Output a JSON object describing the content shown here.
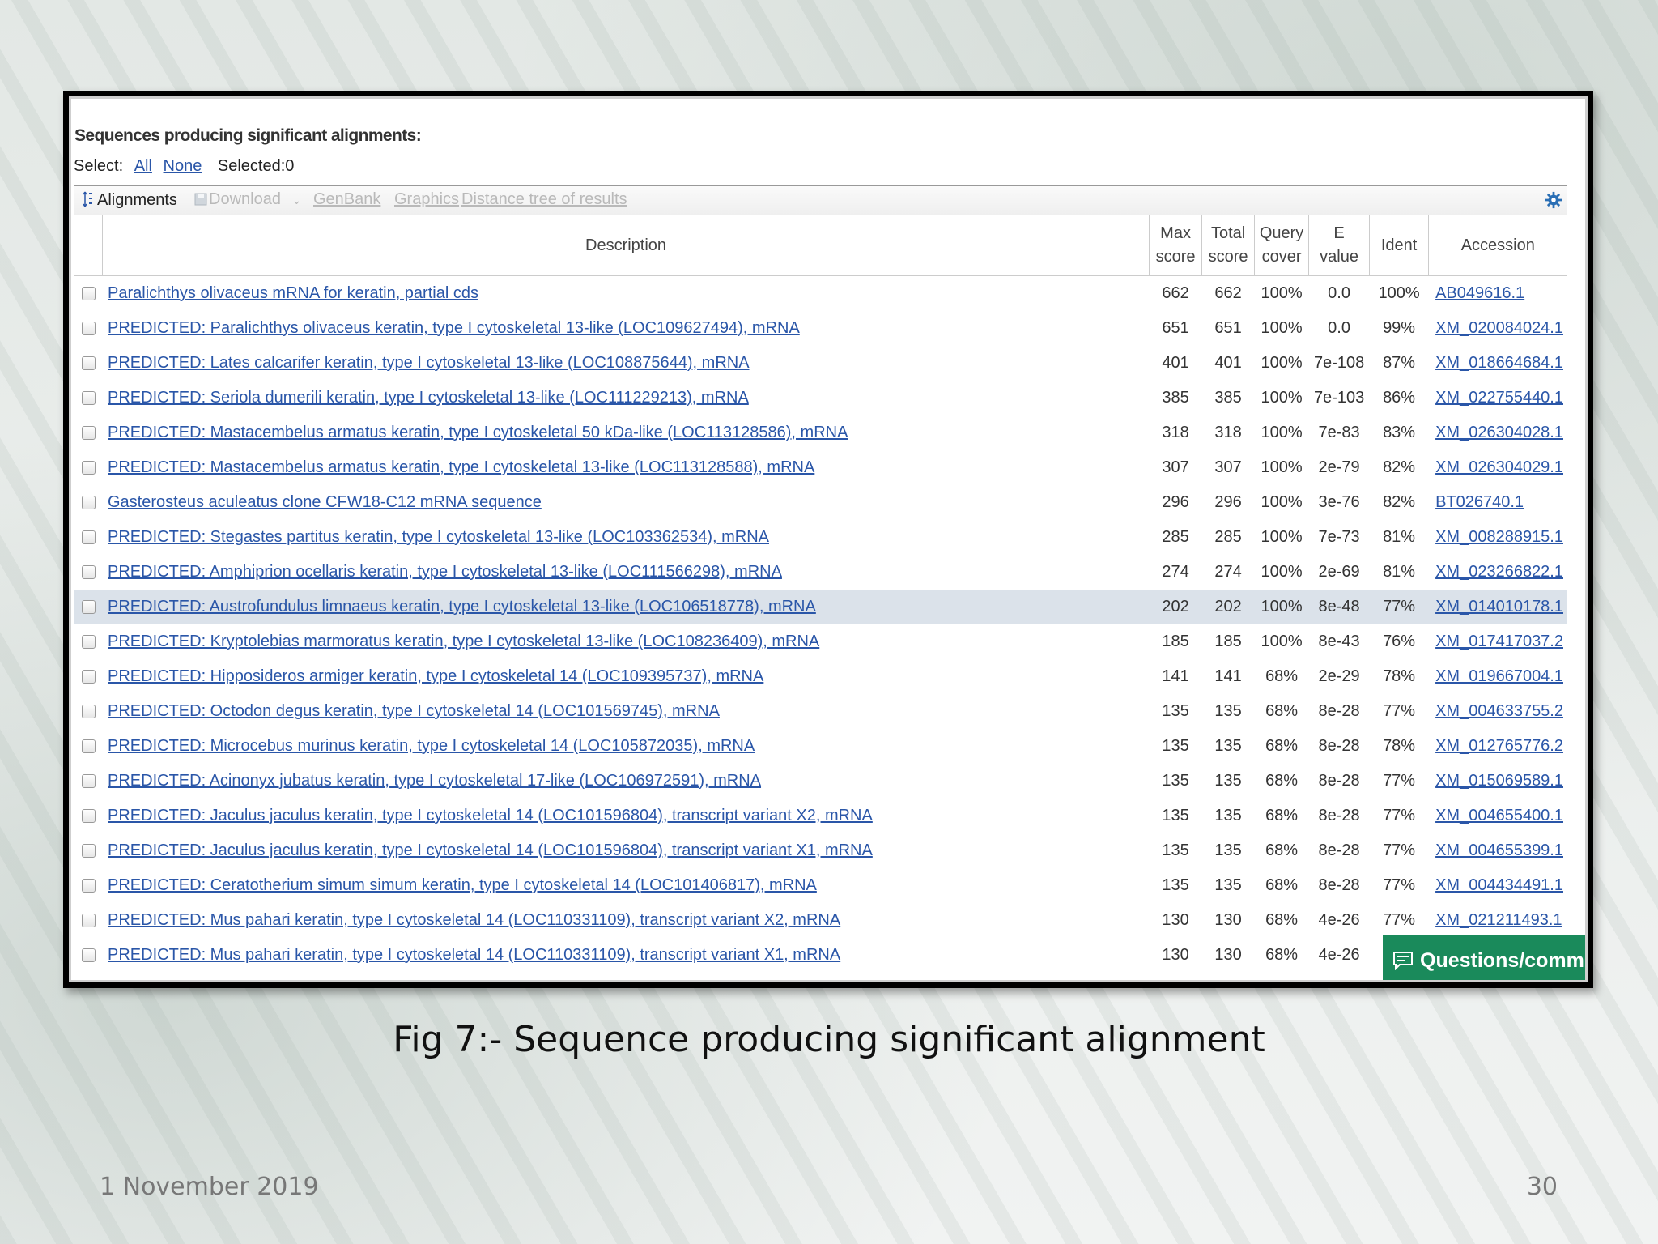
{
  "slide": {
    "caption": "Fig  7:- Sequence producing significant alignment",
    "date": "1 November 2019",
    "page_number": "30"
  },
  "blast": {
    "heading": "Sequences producing significant alignments:",
    "select_label": "Select:",
    "select_all": "All",
    "select_none": "None",
    "selected_text": "Selected:0",
    "toolbar": {
      "alignments": "Alignments",
      "download": "Download",
      "genbank": "GenBank",
      "graphics": "Graphics",
      "distance_tree": "Distance tree of results",
      "settings_icon": "gear-icon"
    },
    "columns": {
      "description": "Description",
      "max_score_1": "Max",
      "max_score_2": "score",
      "total_score_1": "Total",
      "total_score_2": "score",
      "query_cover_1": "Query",
      "query_cover_2": "cover",
      "e_value_1": "E",
      "e_value_2": "value",
      "ident": "Ident",
      "accession": "Accession"
    },
    "rows": [
      {
        "description": "Paralichthys olivaceus mRNA for keratin, partial cds",
        "max": "662",
        "total": "662",
        "cover": "100%",
        "evalue": "0.0",
        "ident": "100%",
        "accession": "AB049616.1"
      },
      {
        "description": "PREDICTED: Paralichthys olivaceus keratin, type I cytoskeletal 13-like (LOC109627494), mRNA",
        "max": "651",
        "total": "651",
        "cover": "100%",
        "evalue": "0.0",
        "ident": "99%",
        "accession": "XM_020084024.1"
      },
      {
        "description": "PREDICTED: Lates calcarifer keratin, type I cytoskeletal 13-like (LOC108875644), mRNA",
        "max": "401",
        "total": "401",
        "cover": "100%",
        "evalue": "7e-108",
        "ident": "87%",
        "accession": "XM_018664684.1"
      },
      {
        "description": "PREDICTED: Seriola dumerili keratin, type I cytoskeletal 13-like (LOC111229213), mRNA",
        "max": "385",
        "total": "385",
        "cover": "100%",
        "evalue": "7e-103",
        "ident": "86%",
        "accession": "XM_022755440.1"
      },
      {
        "description": "PREDICTED: Mastacembelus armatus keratin, type I cytoskeletal 50 kDa-like (LOC113128586), mRNA",
        "max": "318",
        "total": "318",
        "cover": "100%",
        "evalue": "7e-83",
        "ident": "83%",
        "accession": "XM_026304028.1"
      },
      {
        "description": "PREDICTED: Mastacembelus armatus keratin, type I cytoskeletal 13-like (LOC113128588), mRNA",
        "max": "307",
        "total": "307",
        "cover": "100%",
        "evalue": "2e-79",
        "ident": "82%",
        "accession": "XM_026304029.1"
      },
      {
        "description": "Gasterosteus aculeatus clone CFW18-C12 mRNA sequence",
        "max": "296",
        "total": "296",
        "cover": "100%",
        "evalue": "3e-76",
        "ident": "82%",
        "accession": "BT026740.1"
      },
      {
        "description": "PREDICTED: Stegastes partitus keratin, type I cytoskeletal 13-like (LOC103362534), mRNA",
        "max": "285",
        "total": "285",
        "cover": "100%",
        "evalue": "7e-73",
        "ident": "81%",
        "accession": "XM_008288915.1"
      },
      {
        "description": "PREDICTED: Amphiprion ocellaris keratin, type I cytoskeletal 13-like (LOC111566298), mRNA",
        "max": "274",
        "total": "274",
        "cover": "100%",
        "evalue": "2e-69",
        "ident": "81%",
        "accession": "XM_023266822.1"
      },
      {
        "description": "PREDICTED: Austrofundulus limnaeus keratin, type I cytoskeletal 13-like (LOC106518778), mRNA",
        "max": "202",
        "total": "202",
        "cover": "100%",
        "evalue": "8e-48",
        "ident": "77%",
        "accession": "XM_014010178.1",
        "highlighted": true
      },
      {
        "description": "PREDICTED: Kryptolebias marmoratus keratin, type I cytoskeletal 13-like (LOC108236409), mRNA",
        "max": "185",
        "total": "185",
        "cover": "100%",
        "evalue": "8e-43",
        "ident": "76%",
        "accession": "XM_017417037.2"
      },
      {
        "description": "PREDICTED: Hipposideros armiger keratin, type I cytoskeletal 14 (LOC109395737), mRNA",
        "max": "141",
        "total": "141",
        "cover": "68%",
        "evalue": "2e-29",
        "ident": "78%",
        "accession": "XM_019667004.1"
      },
      {
        "description": "PREDICTED: Octodon degus keratin, type I cytoskeletal 14 (LOC101569745), mRNA",
        "max": "135",
        "total": "135",
        "cover": "68%",
        "evalue": "8e-28",
        "ident": "77%",
        "accession": "XM_004633755.2"
      },
      {
        "description": "PREDICTED: Microcebus murinus keratin, type I cytoskeletal 14 (LOC105872035), mRNA",
        "max": "135",
        "total": "135",
        "cover": "68%",
        "evalue": "8e-28",
        "ident": "78%",
        "accession": "XM_012765776.2"
      },
      {
        "description": "PREDICTED: Acinonyx jubatus keratin, type I cytoskeletal 17-like (LOC106972591), mRNA",
        "max": "135",
        "total": "135",
        "cover": "68%",
        "evalue": "8e-28",
        "ident": "77%",
        "accession": "XM_015069589.1"
      },
      {
        "description": "PREDICTED: Jaculus jaculus keratin, type I cytoskeletal 14 (LOC101596804), transcript variant X2, mRNA",
        "max": "135",
        "total": "135",
        "cover": "68%",
        "evalue": "8e-28",
        "ident": "77%",
        "accession": "XM_004655400.1"
      },
      {
        "description": "PREDICTED: Jaculus jaculus keratin, type I cytoskeletal 14 (LOC101596804), transcript variant X1, mRNA",
        "max": "135",
        "total": "135",
        "cover": "68%",
        "evalue": "8e-28",
        "ident": "77%",
        "accession": "XM_004655399.1"
      },
      {
        "description": "PREDICTED: Ceratotherium simum simum keratin, type I cytoskeletal 14 (LOC101406817), mRNA",
        "max": "135",
        "total": "135",
        "cover": "68%",
        "evalue": "8e-28",
        "ident": "77%",
        "accession": "XM_004434491.1"
      },
      {
        "description": "PREDICTED: Mus pahari keratin, type I cytoskeletal 14 (LOC110331109), transcript variant X2, mRNA",
        "max": "130",
        "total": "130",
        "cover": "68%",
        "evalue": "4e-26",
        "ident": "77%",
        "accession": "XM_021211493.1"
      },
      {
        "description": "PREDICTED: Mus pahari keratin, type I cytoskeletal 14 (LOC110331109), transcript variant X1, mRNA",
        "max": "130",
        "total": "130",
        "cover": "68%",
        "evalue": "4e-26",
        "ident": "",
        "accession": ""
      }
    ],
    "feedback_button": "Questions/comm",
    "feedback_icon": "chat-icon",
    "link_color": "#2a56a8",
    "highlight_color": "#dbe2ea",
    "feedback_color": "#1a8a5b"
  }
}
